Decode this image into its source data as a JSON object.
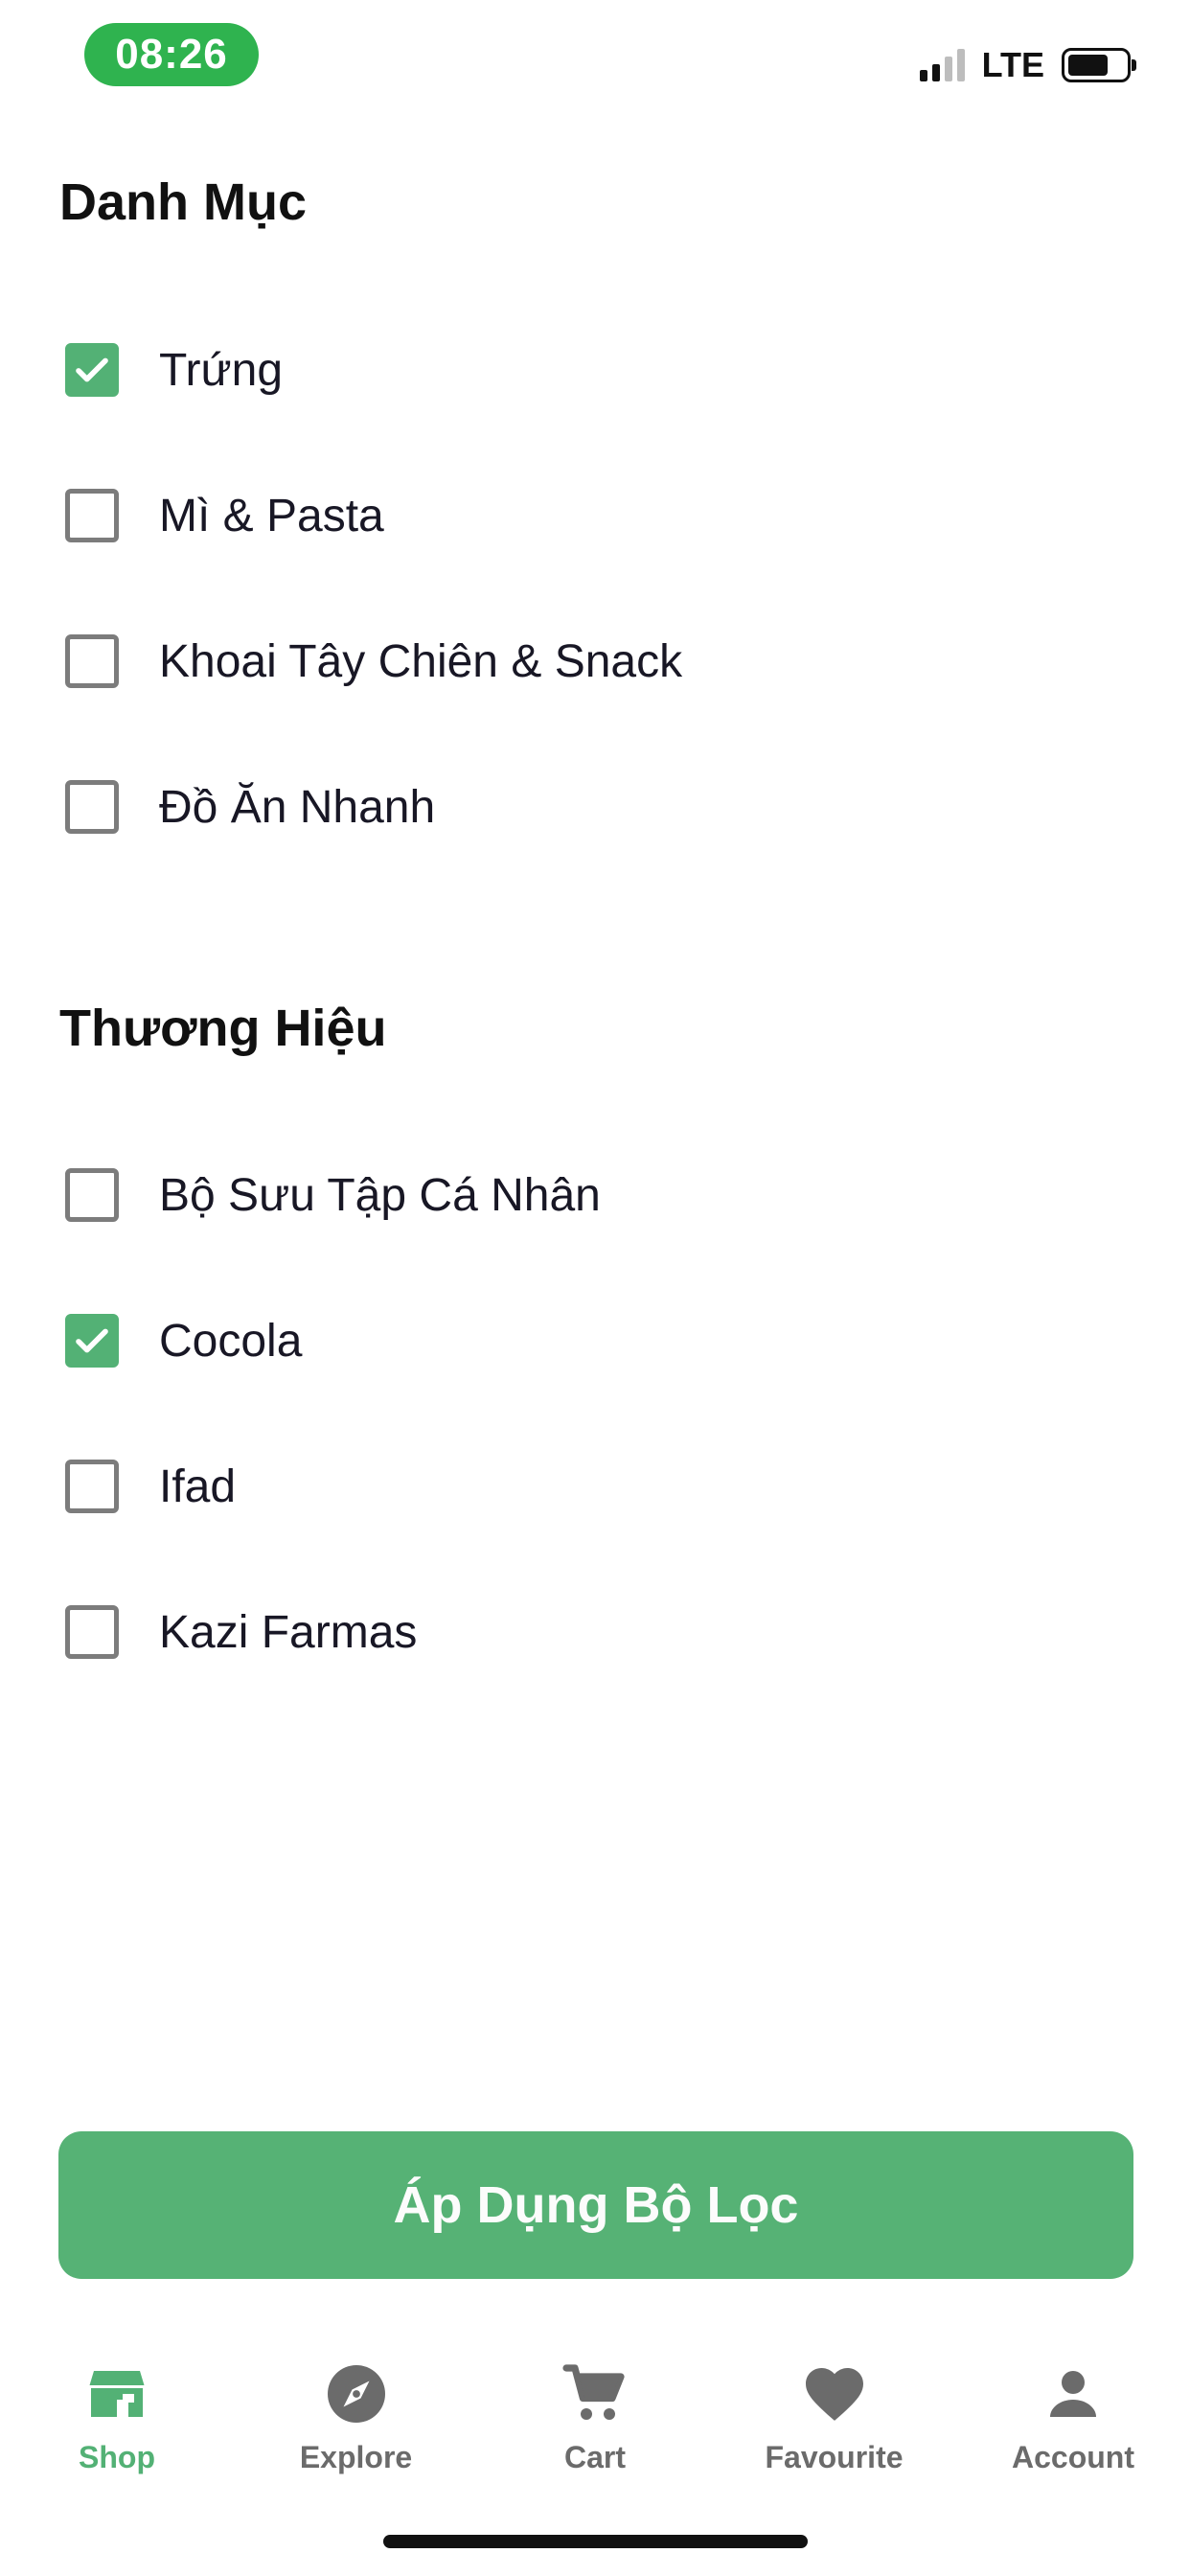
{
  "status_bar": {
    "time": "08:26",
    "network": "LTE",
    "battery_level": 0.7,
    "signal_bars_active": 2
  },
  "categories": {
    "title": "Danh Mục",
    "options": [
      {
        "label": "Trứng",
        "checked": true
      },
      {
        "label": "Mì & Pasta",
        "checked": false
      },
      {
        "label": "Khoai Tây Chiên & Snack",
        "checked": false
      },
      {
        "label": "Đồ Ăn Nhanh",
        "checked": false
      }
    ]
  },
  "brands": {
    "title": "Thương Hiệu",
    "options": [
      {
        "label": "Bộ Sưu Tập Cá Nhân",
        "checked": false
      },
      {
        "label": "Cocola",
        "checked": true
      },
      {
        "label": "Ifad",
        "checked": false
      },
      {
        "label": "Kazi Farmas",
        "checked": false
      }
    ]
  },
  "apply_button": {
    "label": "Áp Dụng Bộ Lọc"
  },
  "tabbar": {
    "active": "shop",
    "tabs": [
      {
        "id": "shop",
        "label": "Shop",
        "icon": "store-icon"
      },
      {
        "id": "explore",
        "label": "Explore",
        "icon": "compass-icon"
      },
      {
        "id": "cart",
        "label": "Cart",
        "icon": "cart-icon"
      },
      {
        "id": "favourite",
        "label": "Favourite",
        "icon": "heart-icon"
      },
      {
        "id": "account",
        "label": "Account",
        "icon": "person-icon"
      }
    ]
  },
  "colors": {
    "accent": "#53B175",
    "time_pill": "#2FB34F",
    "inactive": "#6B6B6B",
    "checkbox_border": "#7C7C7C"
  }
}
